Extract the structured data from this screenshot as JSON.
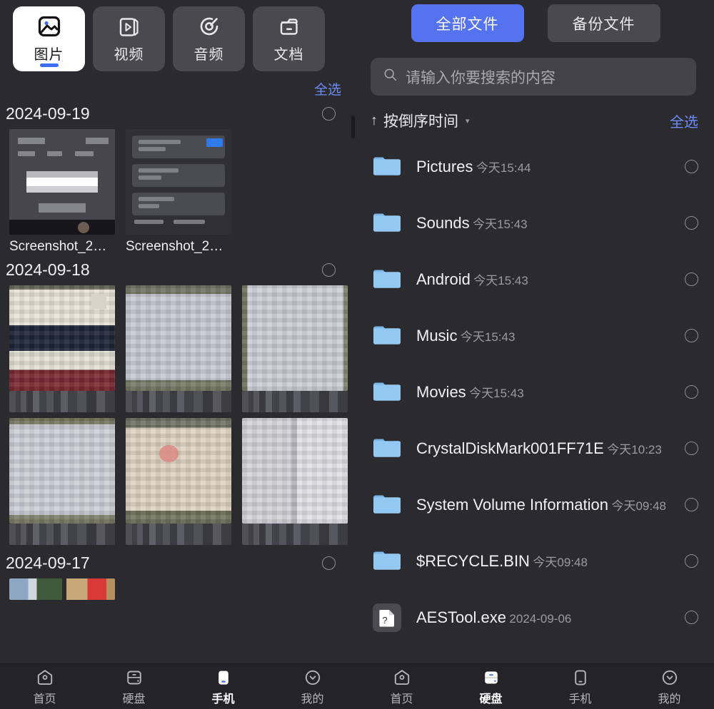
{
  "left": {
    "category_tabs": [
      {
        "label": "图片",
        "icon": "image-icon",
        "active": true
      },
      {
        "label": "视频",
        "icon": "video-icon",
        "active": false
      },
      {
        "label": "音频",
        "icon": "audio-icon",
        "active": false
      },
      {
        "label": "文档",
        "icon": "document-folder-icon",
        "active": false
      }
    ],
    "select_all_label": "全选",
    "groups": [
      {
        "date": "2024-09-19",
        "items": [
          {
            "caption": "Screenshot_2…",
            "redacted": false
          },
          {
            "caption": "Screenshot_2…",
            "redacted": false
          }
        ]
      },
      {
        "date": "2024-09-18",
        "items": [
          {
            "caption": "",
            "redacted": true
          },
          {
            "caption": "",
            "redacted": true
          },
          {
            "caption": "",
            "redacted": true
          },
          {
            "caption": "",
            "redacted": true
          },
          {
            "caption": "",
            "redacted": true
          },
          {
            "caption": "",
            "redacted": true
          }
        ]
      },
      {
        "date": "2024-09-17",
        "items": []
      }
    ]
  },
  "right": {
    "segments": [
      {
        "label": "全部文件",
        "active": true
      },
      {
        "label": "备份文件",
        "active": false
      }
    ],
    "search": {
      "placeholder": "请输入你要搜索的内容",
      "value": "",
      "icon": "search-icon"
    },
    "sort": {
      "arrow": "↑",
      "label": "按倒序时间",
      "caret": "▾"
    },
    "select_all_label": "全选",
    "files": [
      {
        "name": "Pictures",
        "date": "今天15:44",
        "icon": "folder-icon"
      },
      {
        "name": "Sounds",
        "date": "今天15:43",
        "icon": "folder-icon"
      },
      {
        "name": "Android",
        "date": "今天15:43",
        "icon": "folder-icon"
      },
      {
        "name": "Music",
        "date": "今天15:43",
        "icon": "folder-icon"
      },
      {
        "name": "Movies",
        "date": "今天15:43",
        "icon": "folder-icon"
      },
      {
        "name": "CrystalDiskMark001FF71E",
        "date": "今天10:23",
        "icon": "folder-icon"
      },
      {
        "name": "System Volume Information",
        "date": "今天09:48",
        "icon": "folder-icon"
      },
      {
        "name": "$RECYCLE.BIN",
        "date": "今天09:48",
        "icon": "folder-icon"
      },
      {
        "name": "AESTool.exe",
        "date": "2024-09-06",
        "icon": "unknown-file-icon"
      }
    ]
  },
  "bottom_nav_left": [
    {
      "label": "首页",
      "icon": "home-icon",
      "active": false
    },
    {
      "label": "硬盘",
      "icon": "disk-icon",
      "active": false
    },
    {
      "label": "手机",
      "icon": "phone-icon",
      "active": true
    },
    {
      "label": "我的",
      "icon": "profile-icon",
      "active": false
    }
  ],
  "bottom_nav_right": [
    {
      "label": "首页",
      "icon": "home-icon",
      "active": false
    },
    {
      "label": "硬盘",
      "icon": "disk-icon",
      "active": true
    },
    {
      "label": "手机",
      "icon": "phone-icon",
      "active": false
    },
    {
      "label": "我的",
      "icon": "profile-icon",
      "active": false
    }
  ],
  "colors": {
    "background": "#2b2b2f",
    "accent_blue": "#5572f0",
    "link_blue": "#6e8cf5",
    "tab_inactive": "#4a4a4e",
    "folder_blue": "#8ec5f0",
    "nav_bar": "#242428"
  }
}
